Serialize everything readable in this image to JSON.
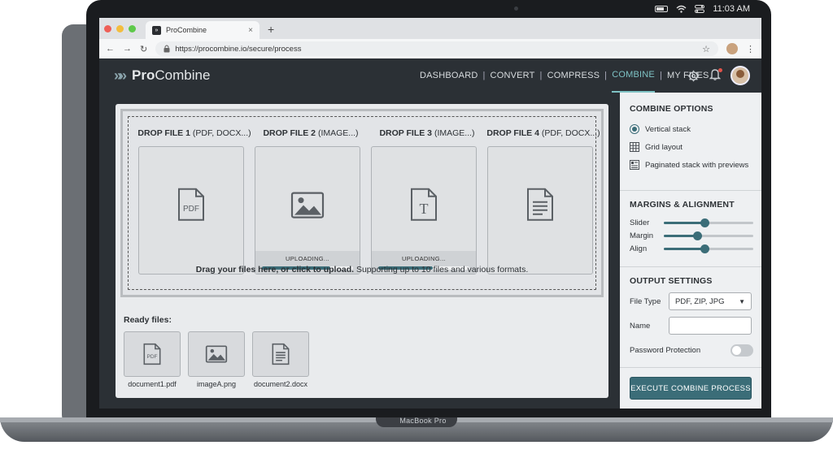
{
  "system": {
    "time": "11:03 AM"
  },
  "browser": {
    "tab_title": "ProCombine",
    "tab_icon": "procombine-favicon",
    "url": "https://procombine.io/secure/process"
  },
  "app": {
    "logo_prefix": "Pro",
    "logo_suffix": "Combine",
    "nav": [
      {
        "label": "DASHBOARD",
        "active": false
      },
      {
        "label": "CONVERT",
        "active": false
      },
      {
        "label": "COMPRESS",
        "active": false
      },
      {
        "label": "COMBINE",
        "active": true
      },
      {
        "label": "MY FILES",
        "active": false
      }
    ],
    "accent": "#3b6d78"
  },
  "dropzone": {
    "slots": [
      {
        "title": "DROP FILE 1",
        "hint": "(PDF, DOCX...)",
        "icon": "pdf-file-icon",
        "uploading": false
      },
      {
        "title": "DROP FILE 2",
        "hint": "(IMAGE...)",
        "icon": "image-file-icon",
        "uploading": true,
        "status": "UPLOADING...",
        "progress": 0.75
      },
      {
        "title": "DROP FILE 3",
        "hint": "(IMAGE...)",
        "icon": "text-file-icon",
        "uploading": true,
        "status": "UPLOADING...",
        "progress": 0.6
      },
      {
        "title": "DROP FILE 4",
        "hint": "(PDF, DOCX...)",
        "icon": "document-file-icon",
        "uploading": false
      }
    ],
    "hint_bold": "Drag your files here, or click to upload.",
    "hint_rest": " Supporting up to 10 files and various formats."
  },
  "ready": {
    "title": "Ready files:",
    "files": [
      {
        "name": "document1.pdf",
        "icon": "pdf-file-icon"
      },
      {
        "name": "imageA.png",
        "icon": "image-file-icon"
      },
      {
        "name": "document2.docx",
        "icon": "document-file-icon"
      }
    ]
  },
  "sidebar": {
    "combine_title": "COMBINE OPTIONS",
    "combine_options": [
      {
        "label": "Vertical stack",
        "icon": "radio-selected-icon",
        "selected": true
      },
      {
        "label": "Grid layout",
        "icon": "grid-icon",
        "selected": false
      },
      {
        "label": "Paginated stack with previews",
        "icon": "paginated-icon",
        "selected": false
      }
    ],
    "margins_title": "MARGINS & ALIGNMENT",
    "sliders": [
      {
        "label": "Slider",
        "value": 0.45
      },
      {
        "label": "Margin",
        "value": 0.37
      },
      {
        "label": "Align",
        "value": 0.45
      }
    ],
    "output_title": "OUTPUT SETTINGS",
    "file_type_label": "File Type",
    "file_type_value": "PDF, ZIP, JPG",
    "name_label": "Name",
    "name_value": "",
    "password_label": "Password Protection",
    "password_enabled": false,
    "execute_label": "EXECUTE COMBINE PROCESS"
  },
  "device": {
    "model": "MacBook Pro"
  }
}
